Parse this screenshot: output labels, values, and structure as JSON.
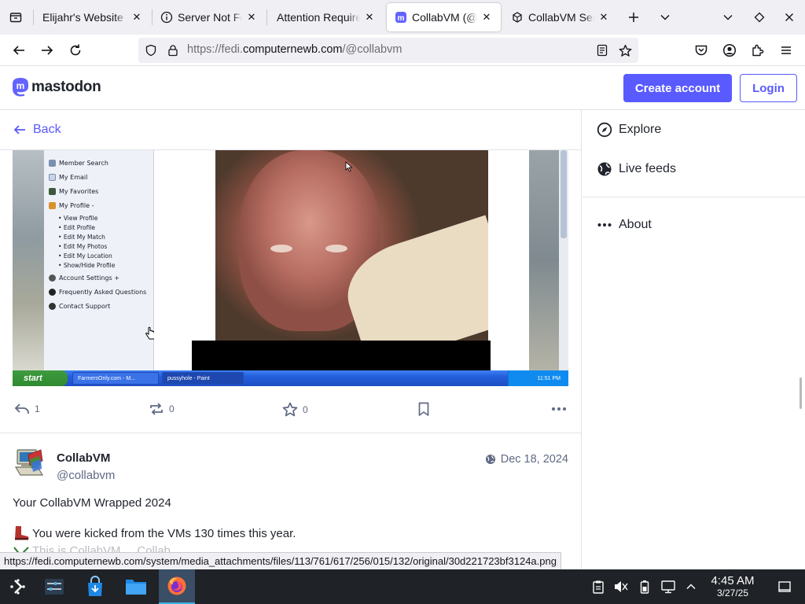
{
  "browser": {
    "tabs": [
      {
        "title": "Elijahr's Website",
        "favicon": "none"
      },
      {
        "title": "Server Not Found",
        "favicon": "info-icon"
      },
      {
        "title": "Attention Required",
        "favicon": "none"
      },
      {
        "title": "CollabVM (@collabvm)",
        "favicon": "mastodon-icon",
        "active": true
      },
      {
        "title": "CollabVM Server",
        "favicon": "collabvm-icon"
      }
    ],
    "url_prefix": "https://fedi.",
    "url_domain": "computernewb.com",
    "url_path": "/@collabvm",
    "status_url": "https://fedi.computernewb.com/system/media_attachments/files/113/761/617/256/015/132/original/30d221723bf3124a.png"
  },
  "mastodon": {
    "logo_text": "mastodon",
    "create_account": "Create account",
    "login": "Login",
    "back": "Back",
    "accent": "#595aff"
  },
  "media_menu": {
    "items": [
      {
        "label": "Member Search"
      },
      {
        "label": "My Email"
      },
      {
        "label": "My Favorites"
      },
      {
        "label": "My Profile -"
      },
      {
        "label": "Account Settings +"
      },
      {
        "label": "Frequently Asked Questions"
      },
      {
        "label": "Contact Support"
      }
    ],
    "subitems": [
      "View Profile",
      "Edit Profile",
      "Edit My Match",
      "Edit My Photos",
      "Edit My Location",
      "Show/Hide Profile"
    ],
    "start": "start",
    "task1": "FarmersOnly.com - M...",
    "task2": "pussyhole - Paint",
    "clock": "11:51 PM"
  },
  "actions": {
    "replies": "1",
    "boosts": "0",
    "favourites": "0"
  },
  "post": {
    "display_name": "CollabVM",
    "handle": "@collabvm",
    "date": "Dec 18, 2024",
    "title": "Your CollabVM Wrapped 2024",
    "line1": "You were kicked from the VMs 130 times this year.",
    "line2": "This is CollabVM ... Collab ... "
  },
  "sidebar": {
    "explore": "Explore",
    "live_feeds": "Live feeds",
    "about": "About"
  },
  "os": {
    "time": "4:45 AM",
    "date": "3/27/25"
  }
}
